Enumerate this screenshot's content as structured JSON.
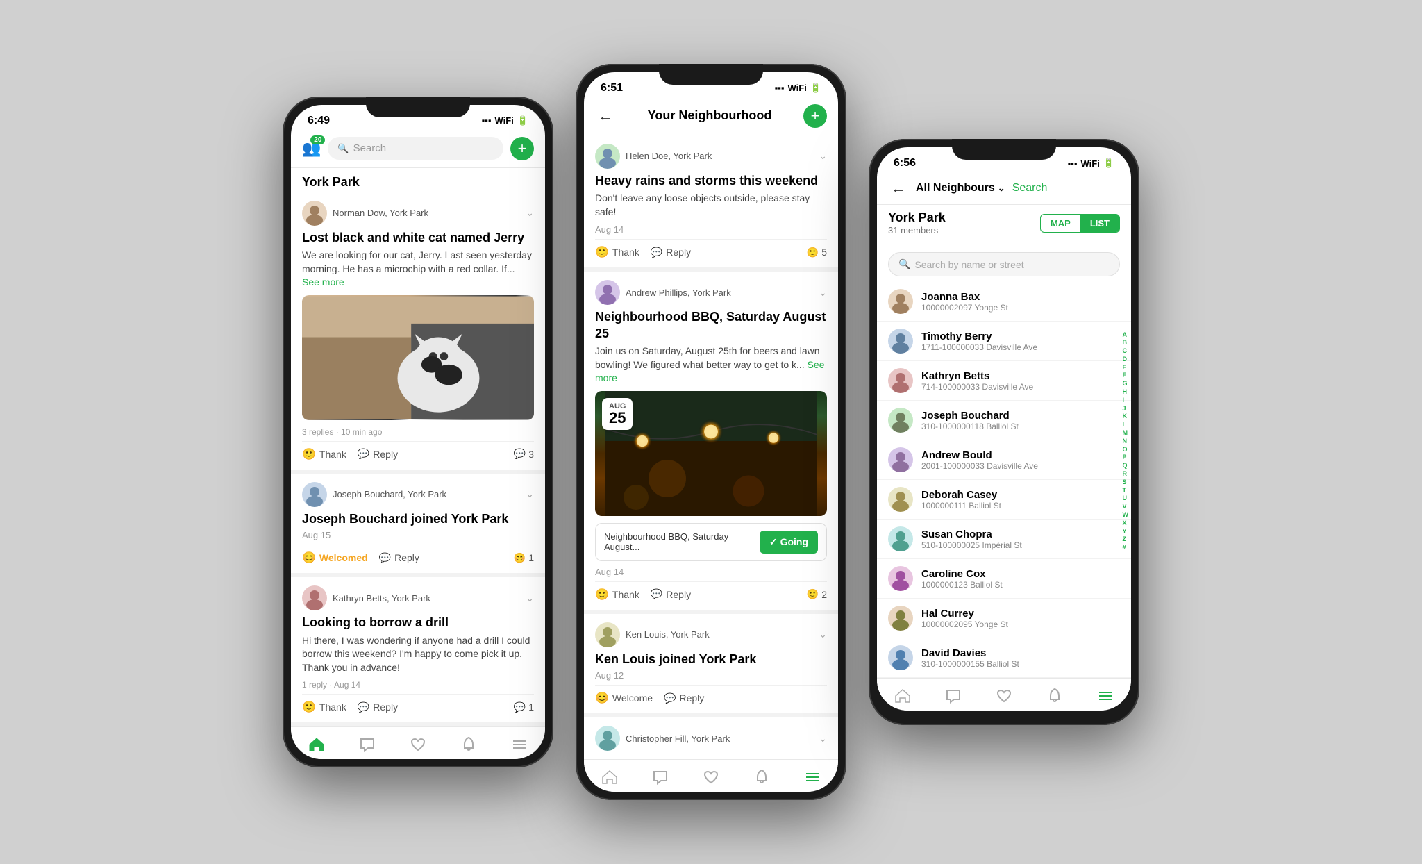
{
  "phones": {
    "phone1": {
      "status_time": "6:49",
      "location": "York Park",
      "search_placeholder": "Search",
      "posts": [
        {
          "author": "Norman Dow, York Park",
          "title": "Lost black and white cat named Jerry",
          "body": "We are looking for our cat, Jerry. Last seen yesterday morning. He has a microchip with a red collar. If...",
          "see_more": "See more",
          "meta": "3 replies · 10 min ago",
          "has_image": true,
          "image_type": "cat",
          "thank_label": "Thank",
          "reply_label": "Reply",
          "reaction_count": "3"
        },
        {
          "author": "Joseph Bouchard, York Park",
          "title": "Joseph Bouchard joined York Park",
          "date": "Aug 15",
          "welcomed_label": "Welcomed",
          "reply_label": "Reply",
          "reaction_count": "1"
        },
        {
          "author": "Kathryn Betts, York Park",
          "title": "Looking to borrow a drill",
          "body": "Hi there, I was wondering if anyone had a drill I could borrow this weekend? I'm happy to come pick it up. Thank you in advance!",
          "meta": "1 reply · Aug 14",
          "thank_label": "Thank",
          "reply_label": "Reply",
          "reaction_count": "1"
        }
      ],
      "nav": {
        "home": "⌂",
        "chat": "💬",
        "heart": "♡",
        "bell": "🔔",
        "menu": "☰"
      }
    },
    "phone2": {
      "status_time": "6:51",
      "header_title": "Your Neighbourhood",
      "posts": [
        {
          "author": "Helen Doe, York Park",
          "title": "Heavy rains and storms this weekend",
          "body": "Don't leave any loose objects outside, please stay safe!",
          "date": "Aug 14",
          "thank_label": "Thank",
          "reply_label": "Reply",
          "reaction_count": "5"
        },
        {
          "author": "Andrew Phillips, York Park",
          "title": "Neighbourhood BBQ, Saturday August 25",
          "body": "Join us on Saturday, August 25th for beers and lawn bowling! We figured what better way to get to k...",
          "see_more": "See more",
          "date": "Aug 14",
          "has_image": true,
          "image_type": "bbq",
          "event_title": "Neighbourhood BBQ, Saturday August...",
          "going_label": "Going",
          "date_badge_month": "Aug",
          "date_badge_day": "25",
          "thank_label": "Thank",
          "reply_label": "Reply",
          "reaction_count": "2"
        },
        {
          "author": "Ken Louis, York Park",
          "title": "Ken Louis joined York Park",
          "date": "Aug 12",
          "welcome_label": "Welcome",
          "reply_label": "Reply"
        },
        {
          "author": "Christopher Fill, York Park",
          "title": "",
          "partial": true
        }
      ]
    },
    "phone3": {
      "status_time": "6:56",
      "header_title": "All Neighbours",
      "search_label": "Search",
      "location": "York Park",
      "members_count": "31 members",
      "search_placeholder": "Search by name or street",
      "map_label": "MAP",
      "list_label": "LIST",
      "neighbours": [
        {
          "name": "Joanna Bax",
          "address": "10000002097 Yonge St"
        },
        {
          "name": "Timothy Berry",
          "address": "1711-100000033 Davisville Ave"
        },
        {
          "name": "Kathryn Betts",
          "address": "714-100000033 Davisville Ave"
        },
        {
          "name": "Joseph Bouchard",
          "address": "310-1000000118 Balliol St"
        },
        {
          "name": "Andrew Bould",
          "address": "2001-100000033 Davisville Ave"
        },
        {
          "name": "Deborah Casey",
          "address": "1000000111 Balliol St"
        },
        {
          "name": "Susan Chopra",
          "address": "510-100000025 Impérial St"
        },
        {
          "name": "Caroline Cox",
          "address": "1000000123 Balliol St"
        },
        {
          "name": "Hal Currey",
          "address": "10000002095 Yonge St"
        },
        {
          "name": "David Davies",
          "address": "310-1000000155 Balliol St"
        }
      ],
      "alphabet": [
        "A",
        "B",
        "C",
        "D",
        "E",
        "F",
        "G",
        "H",
        "I",
        "J",
        "K",
        "L",
        "M",
        "N",
        "O",
        "P",
        "Q",
        "R",
        "S",
        "T",
        "U",
        "V",
        "W",
        "X",
        "Y",
        "Z",
        "#"
      ]
    }
  }
}
